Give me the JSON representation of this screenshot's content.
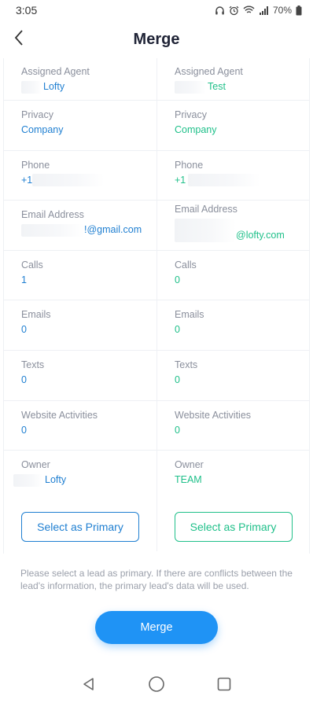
{
  "status_bar": {
    "time": "3:05",
    "battery": "70%",
    "icons": [
      "headphones-icon",
      "alarm-icon",
      "wifi-icon",
      "signal-icon",
      "battery-icon"
    ]
  },
  "header": {
    "title": "Merge",
    "back_icon": "chevron-left-icon"
  },
  "fields": [
    {
      "label": "Assigned Agent",
      "left": "Lofty",
      "right": "Test"
    },
    {
      "label": "Privacy",
      "left": "Company",
      "right": "Company"
    },
    {
      "label": "Phone",
      "left": "+1",
      "right": "+1"
    },
    {
      "label": "Email Address",
      "left": "!@gmail.com",
      "right": "@lofty.com"
    },
    {
      "label": "Calls",
      "left": "1",
      "right": "0"
    },
    {
      "label": "Emails",
      "left": "0",
      "right": "0"
    },
    {
      "label": "Texts",
      "left": "0",
      "right": "0"
    },
    {
      "label": "Website Activities",
      "left": "0",
      "right": "0"
    },
    {
      "label": "Owner",
      "left": "Lofty",
      "right": "TEAM"
    }
  ],
  "actions": {
    "select_primary_left": "Select as Primary",
    "select_primary_right": "Select as Primary"
  },
  "note": "Please select a lead as primary. If there are conflicts between the lead's information, the primary lead's data will be used.",
  "merge_button": "Merge",
  "nav": [
    "back-triangle-icon",
    "home-circle-icon",
    "recents-square-icon"
  ],
  "colors": {
    "left_accent": "#1f7fd1",
    "right_accent": "#20c08a",
    "merge_button": "#1f93f5"
  }
}
